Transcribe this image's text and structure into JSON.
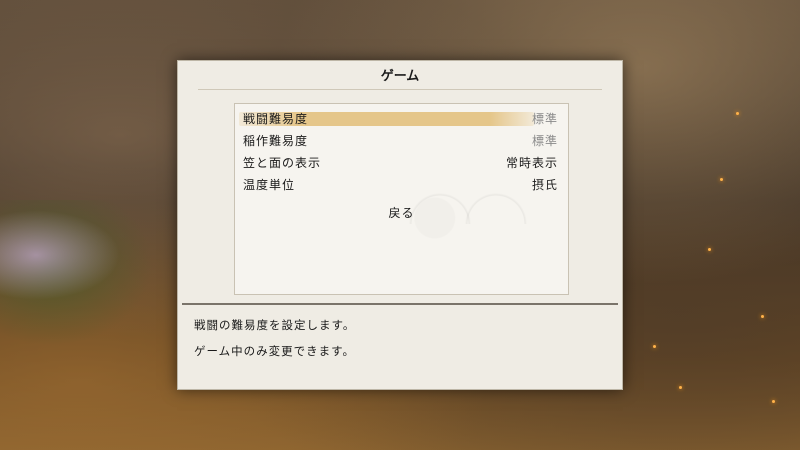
{
  "dialog": {
    "title": "ゲーム",
    "options": [
      {
        "label": "戦闘難易度",
        "value": "標準",
        "selected": true,
        "value_dimmed": true
      },
      {
        "label": "稲作難易度",
        "value": "標準",
        "selected": false,
        "value_dimmed": true
      },
      {
        "label": "笠と面の表示",
        "value": "常時表示",
        "selected": false,
        "value_dimmed": false
      },
      {
        "label": "温度単位",
        "value": "摂氏",
        "selected": false,
        "value_dimmed": false
      }
    ],
    "back_label": "戻る",
    "description": [
      "戦闘の難易度を設定します。",
      "ゲーム中のみ変更できます。"
    ]
  },
  "colors": {
    "highlight": "#e2be78",
    "panel": "#efece4",
    "dim_text": "#8a8a8a"
  }
}
